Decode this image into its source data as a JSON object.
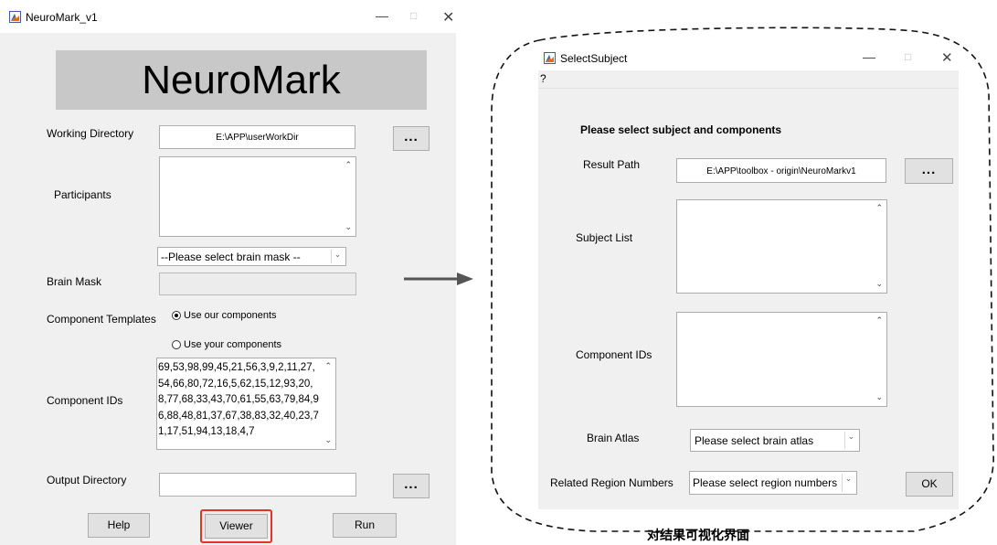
{
  "window1": {
    "title": "NeuroMark_v1",
    "banner": "NeuroMark",
    "working_directory": {
      "label": "Working Directory",
      "value": "E:\\APP\\userWorkDir",
      "browse": "..."
    },
    "participants": {
      "label": "Participants"
    },
    "brain_mask": {
      "label": "Brain Mask",
      "select": "--Please select brain mask --"
    },
    "component_templates": {
      "label": "Component Templates",
      "option1": "Use our components",
      "option2": "Use your components",
      "selected": "option1"
    },
    "component_ids": {
      "label": "Component IDs",
      "value": "69,53,98,99,45,21,56,3,9,2,11,27,54,66,80,72,16,5,62,15,12,93,20,8,77,68,33,43,70,61,55,63,79,84,96,88,48,81,37,67,38,83,32,40,23,71,17,51,94,13,18,4,7"
    },
    "output_directory": {
      "label": "Output Directory",
      "browse": "..."
    },
    "buttons": {
      "help": "Help",
      "viewer": "Viewer",
      "run": "Run"
    },
    "highlight_color": "#e8312a"
  },
  "window2": {
    "title": "SelectSubject",
    "menu": "?",
    "heading": "Please select subject and components",
    "result_path": {
      "label": "Result Path",
      "value": "E:\\APP\\toolbox - origin\\NeuroMarkv1",
      "browse": "..."
    },
    "subject_list": {
      "label": "Subject List"
    },
    "component_ids": {
      "label": "Component IDs"
    },
    "brain_atlas": {
      "label": "Brain Atlas",
      "select": "Please select brain atlas"
    },
    "related_region_numbers": {
      "label": "Related Region Numbers",
      "select": "Please select region numbers"
    },
    "ok": "OK"
  },
  "caption": "对结果可视化界面",
  "icons": [
    "matlab-icon",
    "minimize-icon",
    "maximize-icon",
    "close-icon",
    "right-arrow-icon",
    "chevron-down-icon",
    "scroll-up-icon",
    "scroll-down-icon"
  ]
}
